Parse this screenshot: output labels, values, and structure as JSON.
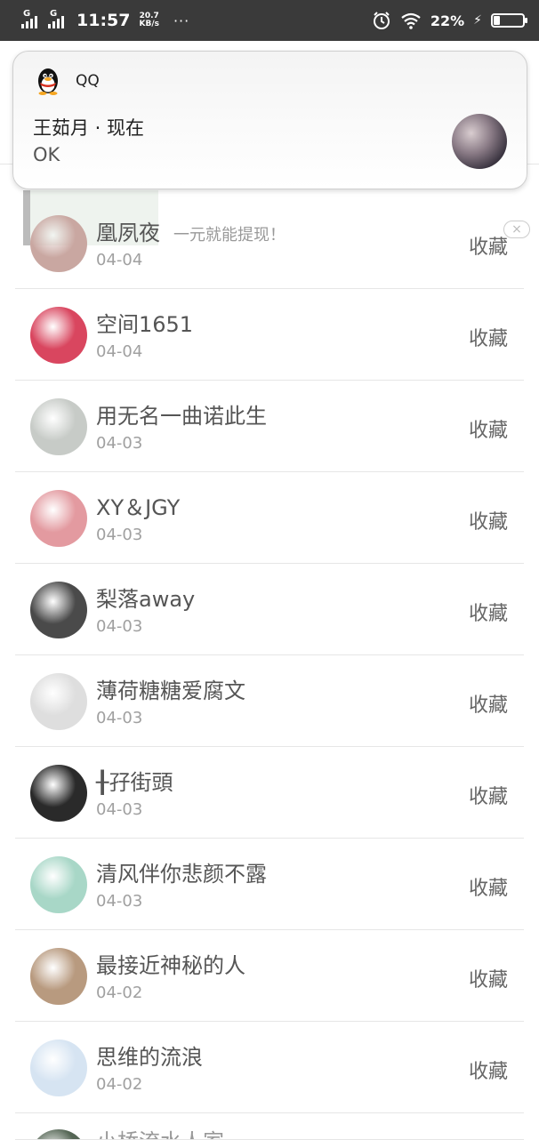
{
  "status_bar": {
    "net1": "G",
    "net2": "G",
    "time": "11:57",
    "speed_value": "20.7",
    "speed_unit": "KB/s",
    "dots": "···",
    "battery_pct": "22%",
    "battery_level": 0.22,
    "icons": [
      "signal-icon",
      "alarm-icon",
      "wifi-icon",
      "charging-icon",
      "battery-icon"
    ]
  },
  "notification": {
    "app_name": "QQ",
    "title": "王茹月 · 现在",
    "body": "OK"
  },
  "behind": {
    "text": "一元就能提现！",
    "close": "×"
  },
  "list": [
    {
      "name": "凰夙夜",
      "date": "04-04",
      "action": "收藏",
      "avatar": "#c9a7a1"
    },
    {
      "name": "空间1651",
      "date": "04-04",
      "action": "收藏",
      "avatar": "#d9465f"
    },
    {
      "name": "用无名一曲诺此生",
      "date": "04-03",
      "action": "收藏",
      "avatar": "#c7cbc7"
    },
    {
      "name": "XY＆JGY",
      "date": "04-03",
      "action": "收藏",
      "avatar": "#e39aa0"
    },
    {
      "name": "梨落away",
      "date": "04-03",
      "action": "收藏",
      "avatar": "#4a4a4a"
    },
    {
      "name": "薄荷糖糖爱腐文",
      "date": "04-03",
      "action": "收藏",
      "avatar": "#dedede"
    },
    {
      "name": "╂孖街頭",
      "date": "04-03",
      "action": "收藏",
      "avatar": "#2a2a2a"
    },
    {
      "name": "清风伴你悲颜不露",
      "date": "04-03",
      "action": "收藏",
      "avatar": "#a8d7c7"
    },
    {
      "name": "最接近神秘的人",
      "date": "04-02",
      "action": "收藏",
      "avatar": "#b89a7f"
    },
    {
      "name": "思维的流浪",
      "date": "04-02",
      "action": "收藏",
      "avatar": "#d6e4f2"
    },
    {
      "name": "小桥流水人家",
      "date": "",
      "action": "",
      "avatar": "#556655"
    }
  ]
}
